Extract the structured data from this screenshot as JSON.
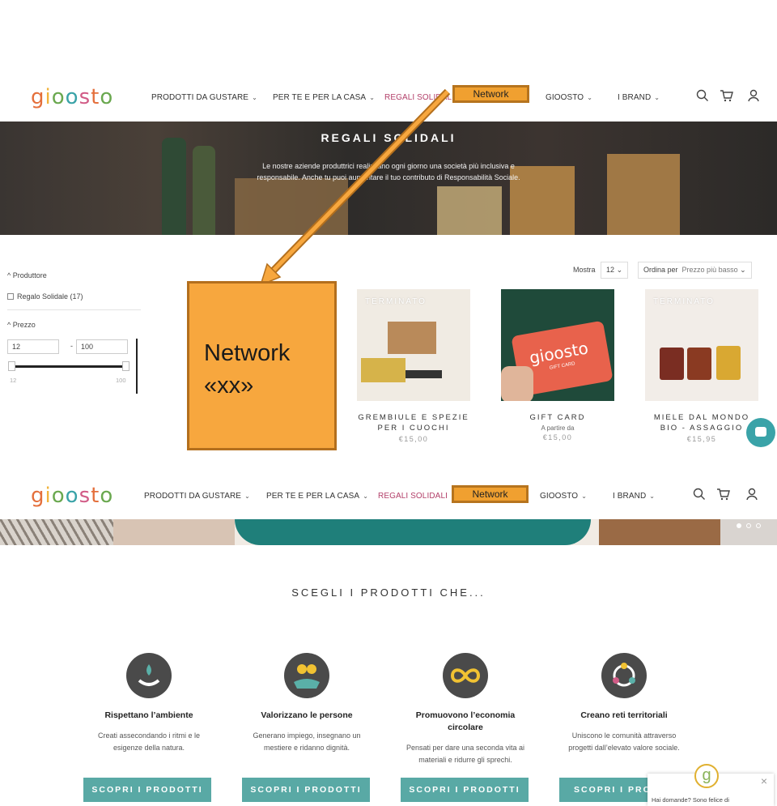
{
  "brand": {
    "logo_text": "gioosto"
  },
  "nav": {
    "items": [
      "PRODOTTI DA GUSTARE",
      "PER TE E PER LA CASA",
      "REGALI SOLIDALI",
      "Network",
      "GIOOSTO",
      "I BRAND"
    ]
  },
  "banner": {
    "title": "REGALI SOLIDALI",
    "subtitle_line1": "Le nostre aziende produttrici realizzano ogni giorno una società più inclusiva e",
    "subtitle_line2": "responsabile. Anche tu puoi aumentare il tuo contributo di Responsabilità Sociale."
  },
  "filters": {
    "produttore_label": "^ Produttore",
    "regalo_option": "Regalo Solidale (17)",
    "prezzo_label": "^ Prezzo",
    "min_value": "12",
    "dash": "-",
    "max_value": "100",
    "range_min_label": "12",
    "range_max_label": "100",
    "slider_level": 1.0
  },
  "sort": {
    "show_label": "Mostra",
    "show_value": "12",
    "order_label": "Ordina per",
    "order_value": "Prezzo più basso"
  },
  "annotation": {
    "line1": "Network",
    "line2": "«xx»"
  },
  "products": [
    {
      "badge": "TERMINATO",
      "name": "GREMBIULE E SPEZIE PER I CUOCHI",
      "from": "",
      "price": "€15,00"
    },
    {
      "badge": "",
      "name": "GIFT CARD",
      "from": "A partire da",
      "price": "€15,00",
      "card_text": "gioosto",
      "card_sub": "GIFT CARD"
    },
    {
      "badge": "TERMINATO",
      "name": "MIELE DAL MONDO BIO - ASSAGGIO",
      "from": "",
      "price": "€15,95"
    }
  ],
  "section": {
    "title": "SCEGLI I PRODOTTI CHE..."
  },
  "features": [
    {
      "title": "Rispettano l’ambiente",
      "desc": "Creati assecondando i ritmi e le esigenze della natura.",
      "button": "SCOPRI I PRODOTTI",
      "icon": "leaf-hand-icon",
      "color": "#4a4a4a"
    },
    {
      "title": "Valorizzano le persone",
      "desc": "Generano impiego, insegnano un mestiere e ridanno dignità.",
      "button": "SCOPRI I PRODOTTI",
      "icon": "people-icon",
      "color": "#4a4a4a"
    },
    {
      "title": "Promuovono l’economia circolare",
      "desc": "Pensati per dare una seconda vita ai materiali e ridurre gli sprechi.",
      "button": "SCOPRI I PRODOTTI",
      "icon": "infinity-icon",
      "color": "#4a4a4a"
    },
    {
      "title": "Creano reti territoriali",
      "desc": "Uniscono le comunità attraverso progetti dall’elevato valore sociale.",
      "button": "SCOPRI I PROD",
      "icon": "network-icon",
      "color": "#4a4a4a"
    }
  ],
  "chat_popup": {
    "message": "Hai domande? Sono felice di",
    "close": "×",
    "logo_letter": "g"
  },
  "colors": {
    "accent": "#59a9a5",
    "network_highlight": "#f0a030",
    "solidali_red": "#b3406a"
  }
}
